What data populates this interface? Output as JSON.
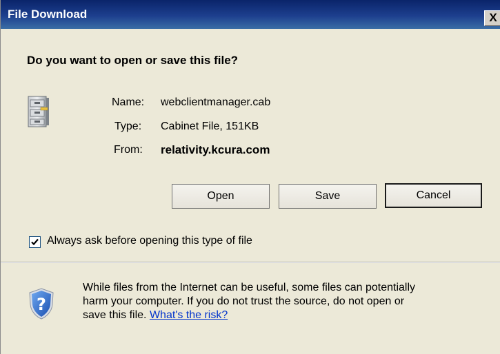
{
  "window": {
    "title": "File Download",
    "close_label": "X"
  },
  "dialog": {
    "question": "Do you want to open or save this file?",
    "file": {
      "name_label": "Name:",
      "name_value": "webclientmanager.cab",
      "type_label": "Type:",
      "type_value": "Cabinet File, 151KB",
      "from_label": "From:",
      "from_value": "relativity.kcura.com"
    },
    "buttons": {
      "open": "Open",
      "save": "Save",
      "cancel": "Cancel"
    },
    "checkbox": {
      "label": "Always ask before opening this type of file",
      "checked": true
    },
    "warning": {
      "line1": "While files from the Internet can be useful, some files can potentially",
      "line2": "harm your computer. If you do not trust the source, do not open or",
      "line3_prefix": "save this file.",
      "link_text": "What's the risk?"
    }
  },
  "icons": {
    "file": "file-cabinet-icon",
    "warning": "security-shield-question-icon",
    "close": "close-icon",
    "check": "check-icon"
  }
}
